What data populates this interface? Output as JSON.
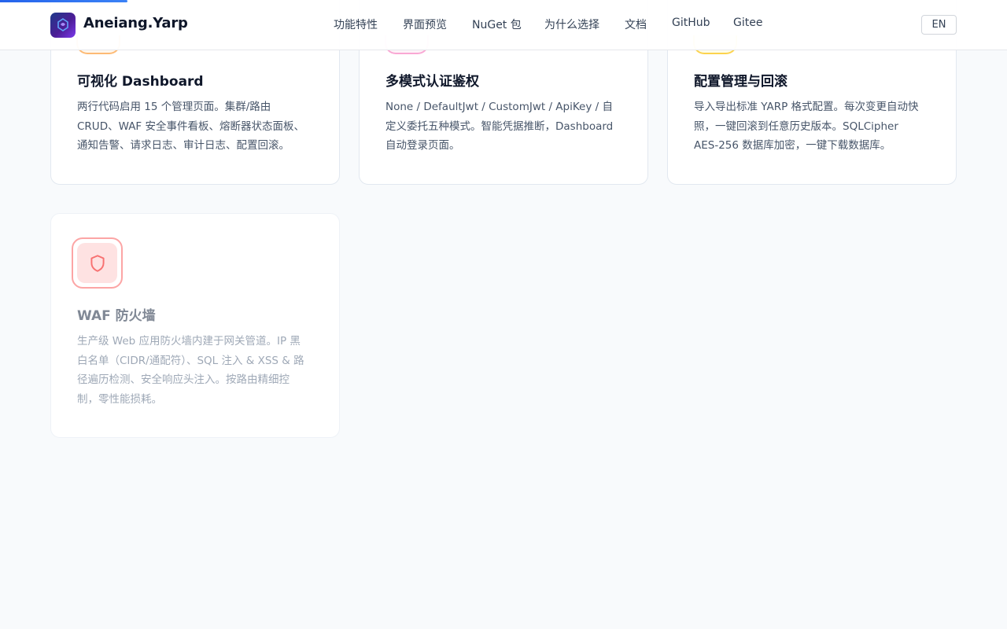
{
  "nav": {
    "brand": "Aneiang.Yarp",
    "links": [
      {
        "label": "功能特性"
      },
      {
        "label": "界面预览"
      },
      {
        "label": "NuGet 包"
      },
      {
        "label": "为什么选择"
      },
      {
        "label": "文档"
      },
      {
        "label": "GitHub"
      },
      {
        "label": "Gitee"
      }
    ],
    "lang_button": "EN"
  },
  "features": [
    {
      "title": "可视化 Dashboard",
      "desc_lines": [
        "两行代码启用 15 个管理页面。集群/路由",
        "CRUD、WAF 安全事件看板、熔断器状态面板、",
        "通知告警、请求日志、审计日志、配置回滚。"
      ],
      "icon": "chart-icon",
      "accent": "#fdba74"
    },
    {
      "title": "多模式认证鉴权",
      "desc_lines": [
        "None / DefaultJwt / CustomJwt / ApiKey / 自",
        "定义委托五种模式。智能凭据推断，Dashboard",
        "自动登录页面。"
      ],
      "icon": "key-icon",
      "accent": "#f9a8d4"
    },
    {
      "title": "配置管理与回滚",
      "desc_lines": [
        "导入导出标准 YARP 格式配置。每次变更自动快",
        "照，一键回滚到任意历史版本。SQLCipher",
        "AES-256 数据库加密，一键下载数据库。"
      ],
      "icon": "database-icon",
      "accent": "#fcd34d"
    },
    {
      "title": "WAF 防火墙",
      "desc_lines": [
        "生产级 Web 应用防火墙内建于网关管道。IP 黑",
        "白名单（CIDR/通配符）、SQL 注入 & XSS & 路",
        "径遍历检测、安全响应头注入。按路由精细控",
        "制，零性能损耗。"
      ],
      "icon": "shield-icon",
      "accent": "#fca5a5"
    }
  ]
}
